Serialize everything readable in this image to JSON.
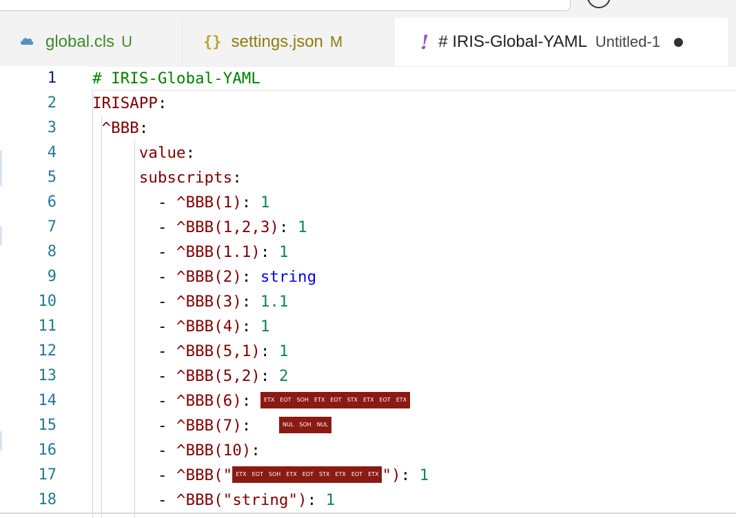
{
  "tabs": [
    {
      "name": "global.cls",
      "status": "U",
      "icon": "iris-cloud-icon"
    },
    {
      "name": "settings.json",
      "status": "M",
      "icon": "json-braces-icon",
      "icon_glyph": "{}"
    },
    {
      "name": "# IRIS-Global-YAML",
      "subtitle": "Untitled-1",
      "icon": "yaml-exclamation-icon",
      "icon_glyph": "!",
      "dirty": true
    }
  ],
  "editor": {
    "active_line": 1,
    "lines": [
      {
        "n": "1",
        "tokens": [
          {
            "t": "# IRIS-Global-YAML",
            "c": "c"
          }
        ]
      },
      {
        "n": "2",
        "tokens": [
          {
            "t": "IRISAPP",
            "c": "k"
          },
          {
            "t": ":",
            "c": "p"
          }
        ]
      },
      {
        "n": "3",
        "tokens": [
          {
            "t": " ",
            "c": "p"
          },
          {
            "t": "^BBB",
            "c": "k"
          },
          {
            "t": ":",
            "c": "p"
          }
        ]
      },
      {
        "n": "4",
        "tokens": [
          {
            "t": "     ",
            "c": "p"
          },
          {
            "t": "value",
            "c": "k"
          },
          {
            "t": ":",
            "c": "p"
          }
        ]
      },
      {
        "n": "5",
        "tokens": [
          {
            "t": "     ",
            "c": "p"
          },
          {
            "t": "subscripts",
            "c": "k"
          },
          {
            "t": ":",
            "c": "p"
          }
        ]
      },
      {
        "n": "6",
        "tokens": [
          {
            "t": "       - ",
            "c": "p"
          },
          {
            "t": "^BBB(1)",
            "c": "k"
          },
          {
            "t": ": ",
            "c": "p"
          },
          {
            "t": "1",
            "c": "n"
          }
        ]
      },
      {
        "n": "7",
        "tokens": [
          {
            "t": "       - ",
            "c": "p"
          },
          {
            "t": "^BBB(1,2,3)",
            "c": "k"
          },
          {
            "t": ": ",
            "c": "p"
          },
          {
            "t": "1",
            "c": "n"
          }
        ]
      },
      {
        "n": "8",
        "tokens": [
          {
            "t": "       - ",
            "c": "p"
          },
          {
            "t": "^BBB(1.1)",
            "c": "k"
          },
          {
            "t": ": ",
            "c": "p"
          },
          {
            "t": "1",
            "c": "n"
          }
        ]
      },
      {
        "n": "9",
        "tokens": [
          {
            "t": "       - ",
            "c": "p"
          },
          {
            "t": "^BBB(2)",
            "c": "k"
          },
          {
            "t": ": ",
            "c": "p"
          },
          {
            "t": "string",
            "c": "s"
          }
        ]
      },
      {
        "n": "10",
        "tokens": [
          {
            "t": "       - ",
            "c": "p"
          },
          {
            "t": "^BBB(3)",
            "c": "k"
          },
          {
            "t": ": ",
            "c": "p"
          },
          {
            "t": "1.1",
            "c": "n"
          }
        ]
      },
      {
        "n": "11",
        "tokens": [
          {
            "t": "       - ",
            "c": "p"
          },
          {
            "t": "^BBB(4)",
            "c": "k"
          },
          {
            "t": ": ",
            "c": "p"
          },
          {
            "t": "1",
            "c": "n"
          }
        ]
      },
      {
        "n": "12",
        "tokens": [
          {
            "t": "       - ",
            "c": "p"
          },
          {
            "t": "^BBB(5,1)",
            "c": "k"
          },
          {
            "t": ": ",
            "c": "p"
          },
          {
            "t": "1",
            "c": "n"
          }
        ]
      },
      {
        "n": "13",
        "tokens": [
          {
            "t": "       - ",
            "c": "p"
          },
          {
            "t": "^BBB(5,2)",
            "c": "k"
          },
          {
            "t": ": ",
            "c": "p"
          },
          {
            "t": "2",
            "c": "n"
          }
        ]
      },
      {
        "n": "14",
        "tokens": [
          {
            "t": "       - ",
            "c": "p"
          },
          {
            "t": "^BBB(6)",
            "c": "k"
          },
          {
            "t": ": ",
            "c": "p"
          },
          {
            "cc": [
              "ETX",
              "EOT",
              "SOH",
              "ETX",
              "EOT",
              "STX",
              "ETX",
              "EOT",
              "ETX"
            ]
          }
        ]
      },
      {
        "n": "15",
        "tokens": [
          {
            "t": "       - ",
            "c": "p"
          },
          {
            "t": "^BBB(7)",
            "c": "k"
          },
          {
            "t": ":   ",
            "c": "p"
          },
          {
            "cc": [
              "NUL",
              "SOH",
              "NUL"
            ]
          }
        ]
      },
      {
        "n": "16",
        "tokens": [
          {
            "t": "       - ",
            "c": "p"
          },
          {
            "t": "^BBB(10)",
            "c": "k"
          },
          {
            "t": ":",
            "c": "p"
          }
        ]
      },
      {
        "n": "17",
        "tokens": [
          {
            "t": "       - ",
            "c": "p"
          },
          {
            "t": "^BBB(\"",
            "c": "k"
          },
          {
            "cc": [
              "ETX",
              "EOT",
              "SOH",
              "ETX",
              "EOT",
              "STX",
              "ETX",
              "EOT",
              "ETX"
            ]
          },
          {
            "t": "\")",
            "c": "k"
          },
          {
            "t": ": ",
            "c": "p"
          },
          {
            "t": "1",
            "c": "n"
          }
        ]
      },
      {
        "n": "18",
        "tokens": [
          {
            "t": "       - ",
            "c": "p"
          },
          {
            "t": "^BBB(\"string\")",
            "c": "k"
          },
          {
            "t": ": ",
            "c": "p"
          },
          {
            "t": "1",
            "c": "n"
          }
        ]
      }
    ]
  },
  "colors": {
    "line_number": "#237893",
    "key": "#800000",
    "comment": "#008000",
    "number": "#098658",
    "string": "#0000ff",
    "control_char_bg": "#8b1a13"
  }
}
